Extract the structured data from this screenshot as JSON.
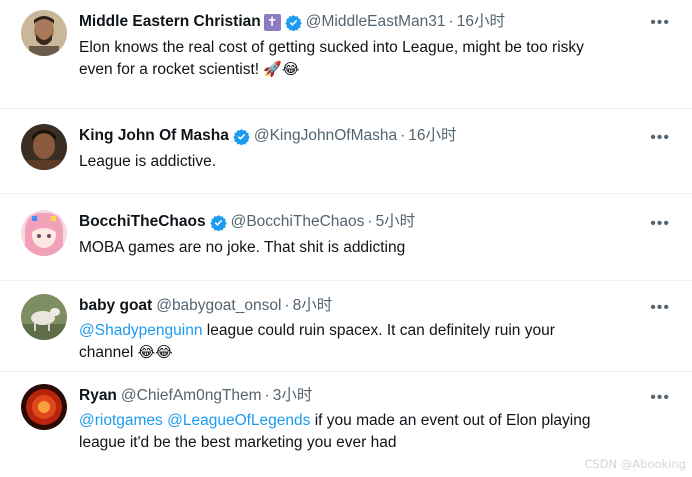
{
  "replies": [
    {
      "name": "Middle Eastern Christian",
      "name_badge": "✝",
      "verified": true,
      "handle": "@MiddleEastMan31",
      "time": "16小时",
      "text_line1": "Elon knows the real cost of getting sucked into League, might be too risky",
      "text_line2": "even for a rocket scientist!",
      "emojis": "🚀😂",
      "avatar": "man-portrait"
    },
    {
      "name": "King John Of Masha",
      "verified": true,
      "handle": "@KingJohnOfMasha",
      "time": "16小时",
      "text": "League is addictive.",
      "avatar": "dark-portrait"
    },
    {
      "name": "BocchiTheChaos",
      "verified": true,
      "handle": "@BocchiTheChaos",
      "time": "5小时",
      "text": "MOBA games are no joke. That shit is addicting",
      "avatar": "pink-anime-girl"
    },
    {
      "name": "baby goat",
      "verified": false,
      "handle": "@babygoat_onsol",
      "time": "8小时",
      "mention": "@Shadypenguinn",
      "text_line1_rest": " league could ruin spacex. It can definitely ruin your",
      "text_line2": "channel",
      "emojis": "😂😂",
      "avatar": "goat"
    },
    {
      "name": "Ryan",
      "verified": false,
      "handle": "@ChiefAm0ngThem",
      "time": "3小时",
      "mention1": "@riotgames",
      "mention2": "@LeagueOfLegends",
      "text_line1_rest": " if you made an event out of Elon playing",
      "text_line2": "league it'd be the best marketing you ever had",
      "avatar": "red-orb"
    }
  ],
  "separator_dot": "·",
  "more_label": "•••",
  "watermark": "CSDN @Abooking",
  "colors": {
    "link": "#1d9bf0",
    "secondary": "#536471",
    "verified": "#1d9bf0"
  }
}
